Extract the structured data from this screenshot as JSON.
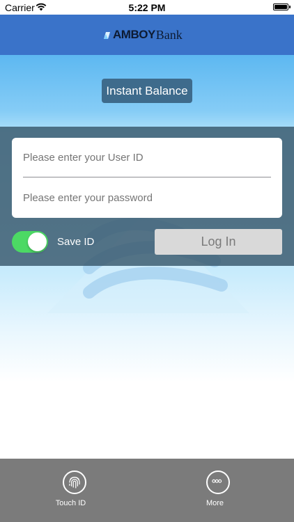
{
  "status_bar": {
    "carrier": "Carrier",
    "time": "5:22 PM"
  },
  "header": {
    "logo_word1": "AMBOY",
    "logo_word2": "Bank"
  },
  "instant_balance": {
    "label": "Instant Balance"
  },
  "login": {
    "user_placeholder": "Please enter your User ID",
    "password_placeholder": "Please enter your password",
    "save_id_label": "Save ID",
    "save_id_on": true,
    "login_label": "Log In"
  },
  "tab_bar": {
    "items": [
      {
        "label": "Touch ID",
        "icon": "fingerprint-icon"
      },
      {
        "label": "More",
        "icon": "more-icon"
      }
    ]
  },
  "colors": {
    "header": "#3a73c9",
    "button": "#3e6b8c",
    "toggle_on": "#4cd964",
    "tab_bar": "#7b7b7b"
  }
}
